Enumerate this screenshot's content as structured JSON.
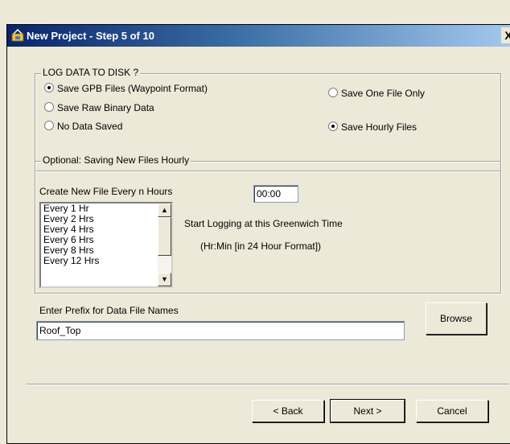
{
  "window": {
    "title": "New Project - Step 5 of 10",
    "close_label": "X"
  },
  "log_group": {
    "legend": "LOG DATA TO DISK ?",
    "options": [
      {
        "label": "Save GPB Files (Waypoint Format)",
        "selected": true
      },
      {
        "label": "Save Raw Binary Data",
        "selected": false
      },
      {
        "label": "No Data Saved",
        "selected": false
      }
    ],
    "file_options": [
      {
        "label": "Save One File Only",
        "selected": false
      },
      {
        "label": "Save Hourly Files",
        "selected": true
      }
    ]
  },
  "hourly_group": {
    "legend": "Optional: Saving New Files Hourly",
    "create_label": "Create New File  Every n Hours",
    "time_value": "00:00",
    "start_label": "Start Logging at this Greenwich Time",
    "format_label": "(Hr:Min [in 24 Hour Format])",
    "intervals": [
      "Every 1  Hr",
      "Every 2  Hrs",
      "Every 4  Hrs",
      "Every 6  Hrs",
      "Every 8  Hrs",
      "Every 12 Hrs"
    ]
  },
  "prefix": {
    "label": "Enter Prefix for Data File Names",
    "value": "Roof_Top",
    "browse_label": "Browse"
  },
  "footer": {
    "back_label": "< Back",
    "next_label": "Next >",
    "cancel_label": "Cancel"
  }
}
